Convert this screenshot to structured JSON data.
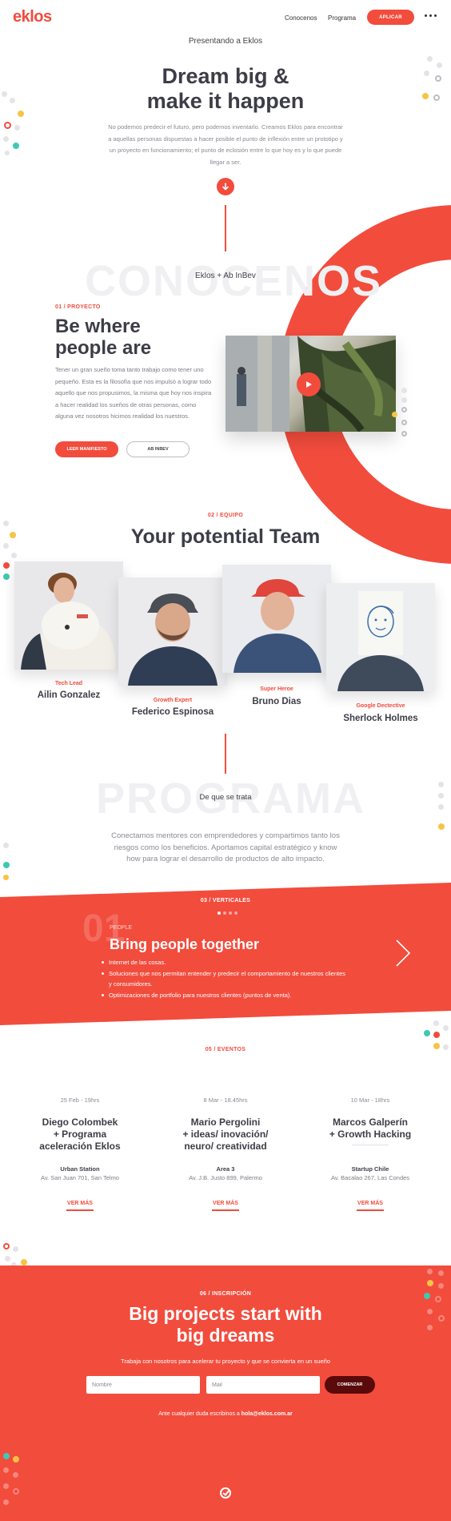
{
  "header": {
    "logo": "eklos",
    "nav": [
      "Conocenos",
      "Programa"
    ],
    "apply_label": "APLICAR"
  },
  "hero": {
    "kicker": "Presentando a Eklos",
    "title_line1": "Dream big &",
    "title_line2": "make it happen",
    "text": "No podemos predecir el futuro, pero podemos inventarlo. Creamos Eklos para encontrar a aquellas personas dispuestas a hacer posible el punto de inflexión entre un prototipo y un proyecto en funcionamiento; el punto de eclosión entre lo que hoy es y lo que puede llegar a ser."
  },
  "project": {
    "bg_word": "CONOCENOS",
    "caption": "Eklos + Ab InBev",
    "kicker": "01 / PROYECTO",
    "title_line1": "Be where",
    "title_line2": "people are",
    "text": "Tener un gran sueño toma tanto trabajo como tener uno pequeño. Esta es la filosofía que nos impulsó a lograr todo aquello que nos propusimos, la misma que hoy nos inspira a hacer realidad los sueños de otras personas, como alguna vez nosotros hicimos realidad los nuestros.",
    "btn_primary": "LEER MANIFIESTO",
    "btn_secondary": "AB INBEV"
  },
  "team": {
    "kicker": "02 / EQUIPO",
    "title": "Your potential Team",
    "members": [
      {
        "role": "Tech Lead",
        "name": "Ailin Gonzalez"
      },
      {
        "role": "Growth Expert",
        "name": "Federico Espinosa"
      },
      {
        "role": "Super Heroe",
        "name": "Bruno Dias"
      },
      {
        "role": "Google Dectective",
        "name": "Sherlock Holmes"
      }
    ]
  },
  "programa": {
    "bg_word": "PROGRAMA",
    "subtitle": "De que se trata",
    "text": "Conectamos mentores con emprendedores y compartimos tanto los riesgos como los beneficios. Aportamos capital estratégico y know how para lograr el desarrollo de productos de alto impacto."
  },
  "verticals": {
    "kicker": "03 / VERTICALES",
    "number": "01",
    "label": "PEOPLE",
    "title": "Bring people together",
    "bullets": [
      "Internet de las cosas.",
      "Soluciones que nos permitan entender y predecir el comportamiento de nuestros clientes y consumidores.",
      "Optimizaciones de portfolio para nuestros clientes (puntos de venta)."
    ]
  },
  "events": {
    "kicker": "05 / EVENTOS",
    "items": [
      {
        "date": "25 Feb - 19hrs",
        "title_lines": [
          "Diego Colombek",
          "+ Programa",
          "aceleración Eklos"
        ],
        "venue": "Urban Station",
        "address": "Av. San Juan 701, San Telmo",
        "link": "VER MÁS"
      },
      {
        "date": "8 Mar - 18.45hrs",
        "title_lines": [
          "Mario Pergolini",
          "+ ideas/ inovación/",
          "neuro/ creatividad"
        ],
        "venue": "Area 3",
        "address": "Av. J.B. Justo 899, Palermo",
        "link": "VER MÁS"
      },
      {
        "date": "10 Mar - 18hrs",
        "title_lines": [
          "Marcos Galperín",
          "+ Growth Hacking"
        ],
        "venue": "Startup Chile",
        "address": "Av. Bacalao 267, Las Condes",
        "link": "VER MÁS"
      }
    ]
  },
  "signup": {
    "kicker": "06 / INSCRIPCIÓN",
    "title_line1": "Big projects start with",
    "title_line2": "big dreams",
    "text": "Trabaja con nosotros para acelerar tu proyecto y que se convierta en un sueño",
    "name_placeholder": "Nombre",
    "mail_placeholder": "Mail",
    "button": "COMENZAR",
    "contact_prefix": "Ante cualquier duda escribinos a",
    "contact_email": "hola@eklos.com.ar"
  },
  "colors": {
    "accent": "#f24c3d",
    "text_dark": "#3d3d48",
    "muted": "#8a8a94",
    "yellow": "#f6c445",
    "teal": "#3ec9b3"
  },
  "icons": [
    "more-dots-icon",
    "arrow-down-icon",
    "play-icon",
    "chevron-right-icon",
    "eklos-mark-icon"
  ]
}
